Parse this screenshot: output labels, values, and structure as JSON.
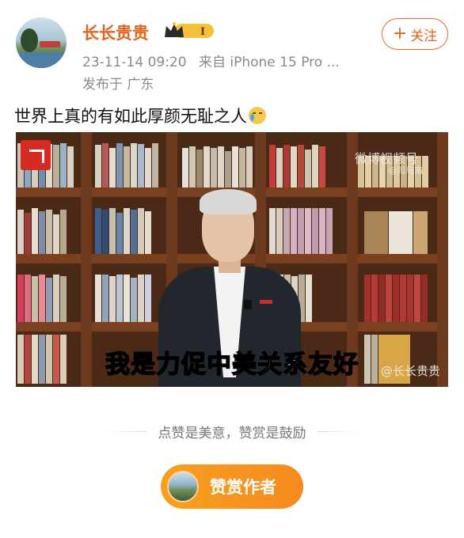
{
  "post": {
    "author": {
      "name": "长长贵贵",
      "badge_level": "I"
    },
    "timestamp": "23-11-14 09:20",
    "source": "来自 iPhone 15 Pro ...",
    "location": "发布于 广东",
    "follow_label": "关注",
    "text": "世界上真的有如此厚颜无耻之人"
  },
  "video": {
    "watermark_top": "微博视频号",
    "watermark_top_sub": "@司马南",
    "subtitle": "我是力促中美关系友好",
    "watermark_bottom": "@长长贵贵"
  },
  "reward": {
    "slogan": "点赞是美意，赞赏是鼓励",
    "button_label": "赞赏作者"
  },
  "colors": {
    "accent_orange": "#e3631f",
    "reward_button": "#f7a020",
    "meta_gray": "#8a8a8a"
  }
}
